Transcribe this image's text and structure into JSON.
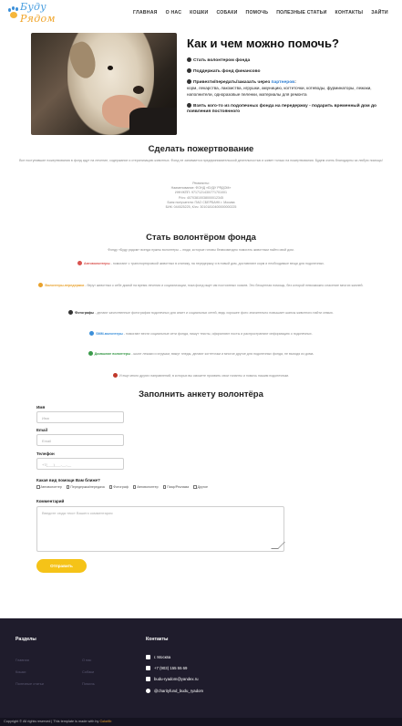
{
  "logo": {
    "text_part1": "Буду",
    "text_part2": "Рядом"
  },
  "nav": [
    "ГЛАВНАЯ",
    "О НАС",
    "КОШКИ",
    "СОБАКИ",
    "ПОМОЧЬ",
    "ПОЛЕЗНЫЕ СТАТЬИ",
    "КОНТАКТЫ",
    "ЗАЙТИ"
  ],
  "hero": {
    "title": "Как и чем можно помочь?",
    "items": [
      {
        "text": "Стать волонтером фонда"
      },
      {
        "text": "Поддержать фонд финансово"
      },
      {
        "text_before": "Привезти/передать/заказать через ",
        "link": "партнеров",
        "text_after": ":",
        "sub": "корм, лекарства, лакомства, игрушки, амуницию, когтеточки, котеводы, фурминаторы, лежаки, наполнители, одноразовые пеленки, материалы для ремонта"
      },
      {
        "text": "Взять кого-то из подопечных фонда на передержку - подарить временный дом до появления постоянного"
      }
    ]
  },
  "donation": {
    "title": "Сделать пожертвование",
    "text": "Все поступившие пожертвования в фонд идут на лечение, содержание и стерилизацию животных. Фонд не занимается предпринимательской деятельностью и живет только на пожертвования. Будем очень благодарны за любую помощь!",
    "requisites": [
      "Реквизиты:",
      "Наименование: ФОНД «БУДУ РЯДОМ»",
      "ИНН/КПП: 9717121430/771701001",
      "Р/сч: 40703810038000012345",
      "Банк получателя: ПАО СБЕРБАНК г. Москва",
      "БИК: 044525225, К/сч: 30101810400000000225"
    ]
  },
  "volunteer": {
    "title": "Стать волонтёром фонда",
    "intro": "Фонду «Буду рядом» всегда нужны волонтеры – люди, которые готовы безвозмездно помогать животным найти свой дом.",
    "items": [
      {
        "label": "Автоволонтеры",
        "color": "#d9534f",
        "text": "- помогают с транспортировкой животных в клинику, на передержку и в новый дом, доставляют корм и необходимые вещи для подопечных."
      },
      {
        "label": "Волонтеры-передержки",
        "color": "#e8a12b",
        "text": "- берут животных к себе домой на время лечения и социализации, пока фонд ищет им постоянных хозяев. Это бесценная помощь, без которой невозможно спасение многих жизней."
      },
      {
        "label": "Фотографы",
        "color": "#333333",
        "text": "- делают качественные фотографии подопечных для анкет и социальных сетей, ведь хорошее фото значительно повышает шансы животного найти семью."
      },
      {
        "label": "SMM-волонтеры",
        "color": "#3b8fd9",
        "text": "- помогают вести социальные сети фонда, пишут тексты, оформляют посты и распространяют информацию о подопечных."
      },
      {
        "label": "Домашние волонтеры",
        "color": "#3a9a4a",
        "text": "- шьют лежаки и игрушки, вяжут пледы, делают когтеточки и многое другое для подопечных фонда, не выходя из дома."
      },
      {
        "label": "",
        "color": "#c0392b",
        "text": "И еще много других направлений, в которых вы сможете проявить свои таланты и помочь нашим подопечным."
      }
    ]
  },
  "form": {
    "title": "Заполнить анкету волонтёра",
    "name_label": "Имя",
    "name_placeholder": "Имя",
    "email_label": "Email",
    "email_placeholder": "Email",
    "phone_label": "Телефон",
    "phone_placeholder": "+7(___)___-__-__",
    "checks_label": "Какая вид помощи Вам ближе?",
    "checks": [
      "Автоволонтер",
      "Передержка/передача",
      "Фотограф",
      "Автоволонтер",
      "Пиар/Реклама",
      "Другое"
    ],
    "comment_label": "Комментарий",
    "comment_placeholder": "Введите сюда текст Вашего комментария",
    "submit": "Отправить"
  },
  "footer": {
    "sections_title": "Разделы",
    "links": [
      "Главная",
      "Кошки",
      "Полезные статьи",
      "О нас",
      "Собаки",
      "Помочь"
    ],
    "contacts_title": "Контакты",
    "contacts": [
      "г. Москва",
      "+7 (903) 155 55 69",
      "budu-ryadom@yandex.ru",
      "@charityfund_budu_ryadom"
    ],
    "copyright_text": "Copyright © All rights reserved | This template is made with by ",
    "copyright_link": "Colorlib"
  }
}
